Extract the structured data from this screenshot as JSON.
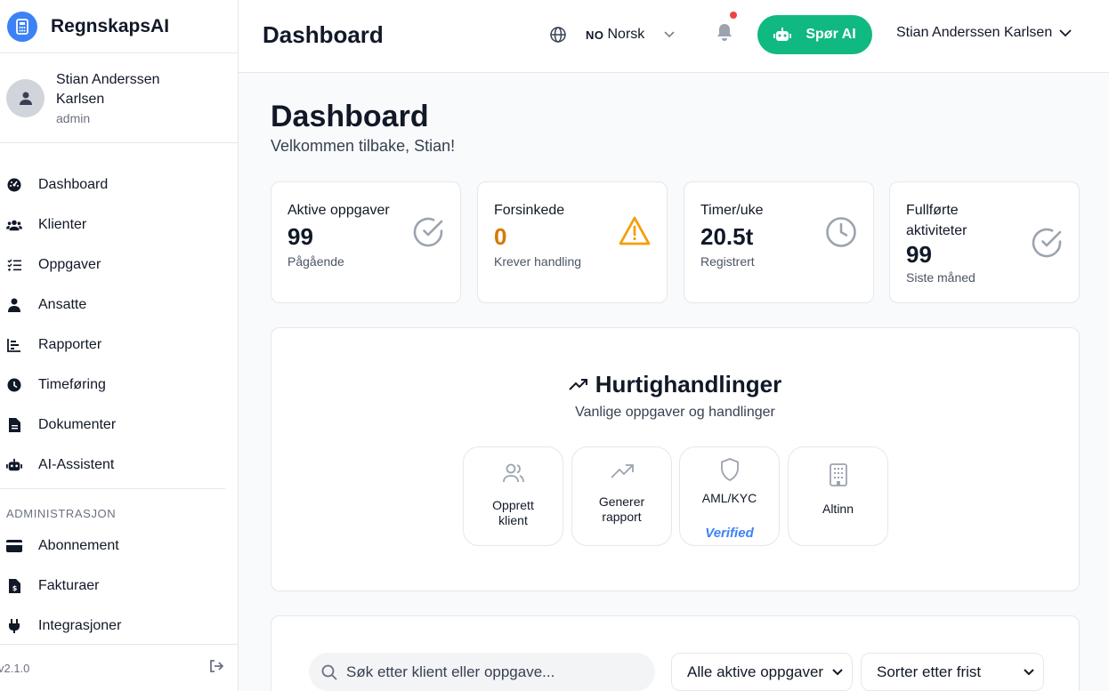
{
  "app": {
    "name": "RegnskapsAI",
    "version": "v2.1.0"
  },
  "user": {
    "name": "Stian Anderssen Karlsen",
    "role": "admin"
  },
  "sidebar": {
    "items": [
      {
        "label": "Dashboard",
        "icon": "dashboard-icon"
      },
      {
        "label": "Klienter",
        "icon": "users-icon"
      },
      {
        "label": "Oppgaver",
        "icon": "tasks-icon"
      },
      {
        "label": "Ansatte",
        "icon": "employee-icon"
      },
      {
        "label": "Rapporter",
        "icon": "chart-icon"
      },
      {
        "label": "Timeføring",
        "icon": "clock-icon"
      },
      {
        "label": "Dokumenter",
        "icon": "document-icon"
      },
      {
        "label": "AI-Assistent",
        "icon": "robot-icon"
      }
    ],
    "admin_section": "ADMINISTRASJON",
    "admin_items": [
      {
        "label": "Abonnement",
        "icon": "credit-card-icon"
      },
      {
        "label": "Fakturaer",
        "icon": "invoice-icon"
      },
      {
        "label": "Integrasjoner",
        "icon": "plug-icon"
      }
    ]
  },
  "topbar": {
    "title": "Dashboard",
    "language_code": "NO",
    "language_name": "Norsk",
    "ask_ai_label": "Spør AI",
    "user_menu": "Stian Anderssen Karlsen"
  },
  "page": {
    "title": "Dashboard",
    "subtitle": "Velkommen tilbake, Stian!"
  },
  "stats": [
    {
      "label": "Aktive oppgaver",
      "value": "99",
      "note": "Pågående",
      "icon": "check-circle-icon"
    },
    {
      "label": "Forsinkede",
      "value": "0",
      "note": "Krever handling",
      "icon": "warning-icon"
    },
    {
      "label": "Timer/uke",
      "value": "20.5t",
      "note": "Registrert",
      "icon": "clock-icon"
    },
    {
      "label": "Fullførte aktiviteter",
      "value": "99",
      "note": "Siste måned",
      "icon": "check-circle-icon"
    }
  ],
  "quick_actions": {
    "title": "Hurtighandlinger",
    "subtitle": "Vanlige oppgaver og handlinger",
    "items": [
      {
        "label": "Opprett klient",
        "icon": "users-icon"
      },
      {
        "label": "Generer rapport",
        "icon": "trending-up-icon"
      },
      {
        "label": "AML/KYC",
        "icon": "shield-icon",
        "badge": "Verified"
      },
      {
        "label": "Altinn",
        "icon": "building-icon"
      }
    ]
  },
  "filters": {
    "search_placeholder": "Søk etter klient eller oppgave...",
    "status_select": "Alle aktive oppgaver",
    "sort_select": "Sorter etter frist"
  },
  "colors": {
    "primary": "#3b82f6",
    "success": "#10b981",
    "warning": "#d97706",
    "notification": "#ef4444"
  }
}
